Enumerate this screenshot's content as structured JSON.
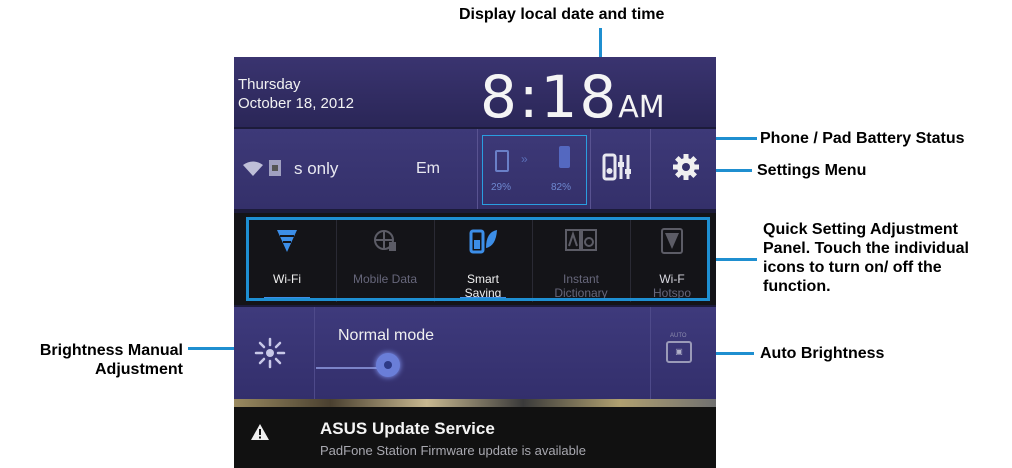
{
  "annotations": {
    "datetime": "Display local date and time",
    "battery": "Phone / Pad Battery Status",
    "settings": "Settings Menu",
    "quick": [
      "Quick Setting Adjustment",
      "Panel. Touch the individual",
      "icons to turn on/ off the",
      "function."
    ],
    "brightness": [
      "Brightness Manual",
      "Adjustment"
    ],
    "auto": "Auto Brightness"
  },
  "header": {
    "day": "Thursday",
    "date": "October 18, 2012",
    "time": "8:18",
    "ampm": "AM"
  },
  "status": {
    "network": "s only",
    "emergency": "Em",
    "phone_pct": "29%",
    "pad_pct": "82%"
  },
  "quick_settings": {
    "wifi": "Wi-Fi",
    "mobile_data": "Mobile Data",
    "smart_saving": [
      "Smart",
      "Saving"
    ],
    "instant_dictionary": [
      "Instant",
      "Dictionary"
    ],
    "hotspot": [
      "Wi-F",
      "Hotspo"
    ]
  },
  "brightness": {
    "mode": "Normal mode",
    "auto_label": "AUTO"
  },
  "notification": {
    "title": "ASUS Update Service",
    "subtitle": "PadFone Station Firmware update is available"
  },
  "colors": {
    "accent": "#1e8fd2",
    "panel": "#34306a",
    "active_icon": "#3c8ee8"
  },
  "icons": [
    "wifi-icon",
    "sim-icon",
    "phone-battery-icon",
    "pad-battery-icon",
    "sliders-icon",
    "gear-icon",
    "mobile-data-icon",
    "smart-saving-icon",
    "dictionary-icon",
    "hotspot-icon",
    "sun-icon",
    "auto-brightness-icon",
    "warning-icon"
  ]
}
